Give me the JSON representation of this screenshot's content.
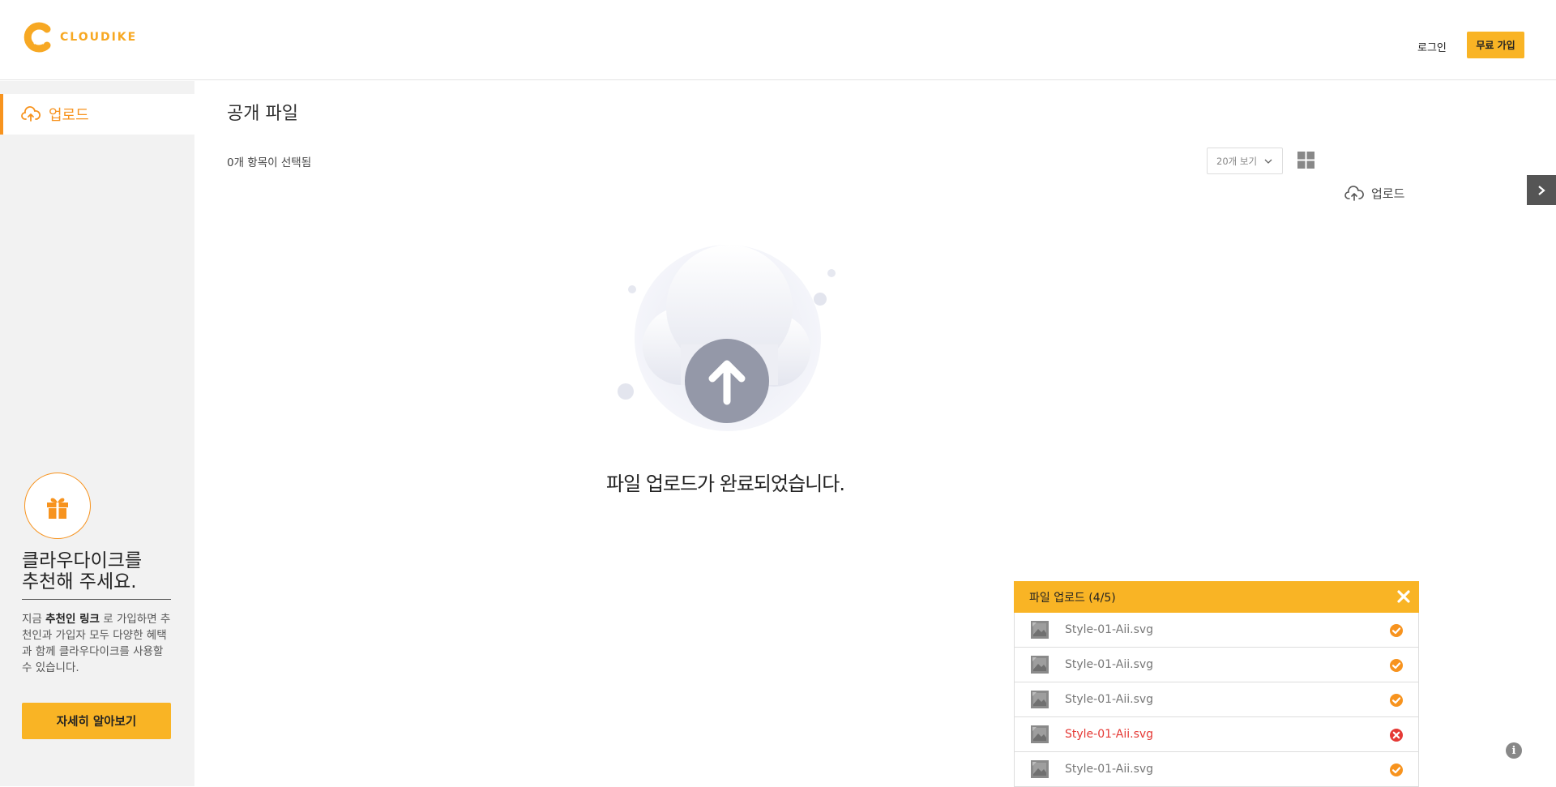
{
  "header": {
    "logo_text": "CLOUDIKE",
    "login_label": "로그인",
    "signup_label": "무료 가입"
  },
  "sidebar": {
    "active_item": {
      "label": "업로드",
      "icon": "cloud-upload-icon"
    },
    "promo": {
      "icon": "gift-icon",
      "title_line1": "클라우다이크를",
      "title_line2": "추천해 주세요.",
      "desc_prefix": "지금 ",
      "desc_bold": "추천인 링크",
      "desc_suffix": " 로 가입하면 추천인과 가입자 모두 다양한 혜택과 함께 클라우다이크를 사용할 수 있습니다.",
      "button_label": "자세히 알아보기"
    }
  },
  "main": {
    "title": "공개 파일",
    "selected_count": "0개 항목이 선택됨",
    "view_select": "20개 보기",
    "upload_label": "업로드",
    "done_message": "파일 업로드가 완료되었습니다."
  },
  "upload_panel": {
    "title": "파일 업로드 (4/5)",
    "files": [
      {
        "name": "Style-01-Aii.svg",
        "status": "success"
      },
      {
        "name": "Style-01-Aii.svg",
        "status": "success"
      },
      {
        "name": "Style-01-Aii.svg",
        "status": "success"
      },
      {
        "name": "Style-01-Aii.svg",
        "status": "error"
      },
      {
        "name": "Style-01-Aii.svg",
        "status": "success"
      }
    ]
  },
  "colors": {
    "accent": "#f7931e",
    "button_yellow": "#f9b425",
    "error": "#e53935",
    "sidebar_bg": "#f2f2f2"
  }
}
